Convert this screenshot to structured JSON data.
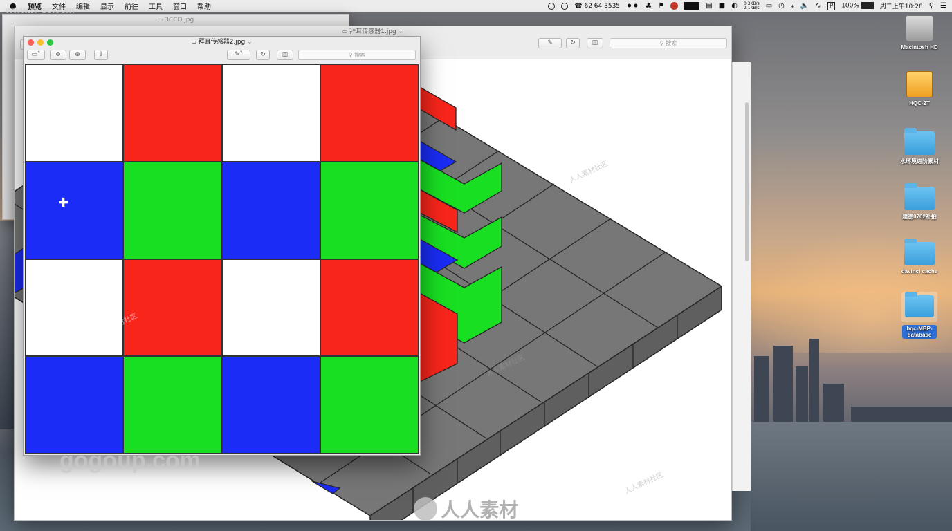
{
  "menubar": {
    "apple": "",
    "items": [
      "预览",
      "文件",
      "编辑",
      "显示",
      "前往",
      "工具",
      "窗口",
      "帮助"
    ],
    "phone": "62 64 3535",
    "net_up": "0.3KB/s",
    "net_down": "2.1KB/s",
    "battery": "100%",
    "clock": "周二上午10:28"
  },
  "windows": {
    "back_far": {
      "title": "3CCD.jpg"
    },
    "back": {
      "title": "拜耳传感器1.jpg",
      "search_placeholder": "搜索"
    },
    "front": {
      "title": "拜耳传感器2.jpg",
      "search_placeholder": "搜索"
    }
  },
  "bayer_grid": {
    "rows": [
      [
        "white",
        "red",
        "white",
        "red"
      ],
      [
        "blue",
        "green",
        "blue",
        "green"
      ],
      [
        "white",
        "red",
        "white",
        "red"
      ],
      [
        "blue",
        "green",
        "blue",
        "green"
      ]
    ],
    "colors": {
      "white": "#ffffff",
      "red": "#f8251b",
      "green": "#18df22",
      "blue": "#1a2cf5"
    }
  },
  "desktop_icons": [
    {
      "label": "Macintosh HD",
      "kind": "hdd"
    },
    {
      "label": "HQC-2T",
      "kind": "hdd-orange"
    },
    {
      "label": "水环境进阶素材",
      "kind": "folder"
    },
    {
      "label": "建德0702补拍",
      "kind": "folder"
    },
    {
      "label": "davinci  cache",
      "kind": "folder"
    },
    {
      "label": "hqc-MBP-database",
      "kind": "folder"
    }
  ],
  "watermarks": {
    "top_left": "www.rr-sc.com",
    "bottom_left": "gogoup.com",
    "bottom_center": "人人素材",
    "repeated": "人人素材社区"
  }
}
